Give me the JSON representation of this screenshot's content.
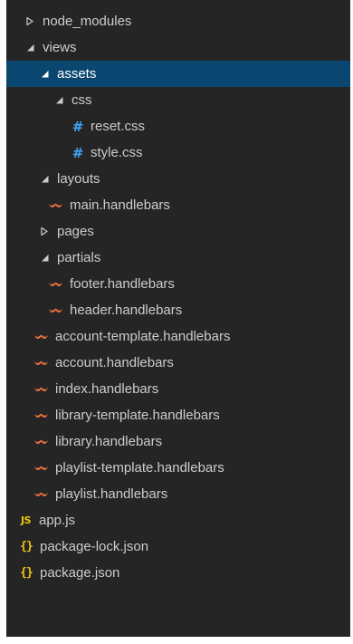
{
  "colors": {
    "panel_background": "#252526",
    "selected_row": "#094771",
    "text": "#cccccc",
    "css_icon": "#42a5f5",
    "handlebars_icon": "#f0733e",
    "js_icon": "#f1c40f",
    "json_icon": "#f1c40f"
  },
  "tree": {
    "items": [
      {
        "label": "node_modules",
        "kind": "folder",
        "expanded": false,
        "icon": "chevron-right-icon"
      },
      {
        "label": "views",
        "kind": "folder",
        "expanded": true,
        "icon": "chevron-down-icon"
      },
      {
        "label": "assets",
        "kind": "folder",
        "expanded": true,
        "selected": true,
        "icon": "chevron-down-icon"
      },
      {
        "label": "css",
        "kind": "folder",
        "expanded": true,
        "icon": "chevron-down-icon"
      },
      {
        "label": "reset.css",
        "kind": "file",
        "icon": "css-file-icon",
        "glyph": "#"
      },
      {
        "label": "style.css",
        "kind": "file",
        "icon": "css-file-icon",
        "glyph": "#"
      },
      {
        "label": "layouts",
        "kind": "folder",
        "expanded": true,
        "icon": "chevron-down-icon"
      },
      {
        "label": "main.handlebars",
        "kind": "file",
        "icon": "handlebars-file-icon"
      },
      {
        "label": "pages",
        "kind": "folder",
        "expanded": false,
        "icon": "chevron-right-icon"
      },
      {
        "label": "partials",
        "kind": "folder",
        "expanded": true,
        "icon": "chevron-down-icon"
      },
      {
        "label": "footer.handlebars",
        "kind": "file",
        "icon": "handlebars-file-icon"
      },
      {
        "label": "header.handlebars",
        "kind": "file",
        "icon": "handlebars-file-icon"
      },
      {
        "label": "account-template.handlebars",
        "kind": "file",
        "icon": "handlebars-file-icon"
      },
      {
        "label": "account.handlebars",
        "kind": "file",
        "icon": "handlebars-file-icon"
      },
      {
        "label": "index.handlebars",
        "kind": "file",
        "icon": "handlebars-file-icon"
      },
      {
        "label": "library-template.handlebars",
        "kind": "file",
        "icon": "handlebars-file-icon"
      },
      {
        "label": "library.handlebars",
        "kind": "file",
        "icon": "handlebars-file-icon"
      },
      {
        "label": "playlist-template.handlebars",
        "kind": "file",
        "icon": "handlebars-file-icon"
      },
      {
        "label": "playlist.handlebars",
        "kind": "file",
        "icon": "handlebars-file-icon"
      },
      {
        "label": "app.js",
        "kind": "file",
        "icon": "js-file-icon",
        "glyph": "JS"
      },
      {
        "label": "package-lock.json",
        "kind": "file",
        "icon": "json-file-icon",
        "glyph": "{}"
      },
      {
        "label": "package.json",
        "kind": "file",
        "icon": "json-file-icon",
        "glyph": "{}"
      }
    ]
  }
}
